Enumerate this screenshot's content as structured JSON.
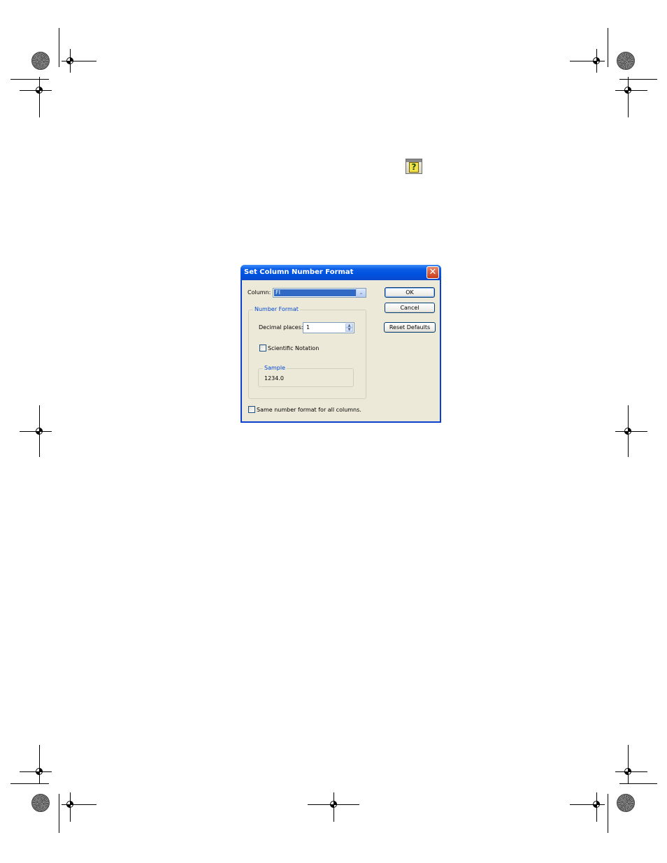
{
  "help_icon": {
    "icon": "help-question-icon",
    "glyph": "?"
  },
  "dialog": {
    "title": "Set Column Number Format",
    "close_glyph": "✕",
    "column": {
      "label": "Column:",
      "value": "FI",
      "arrow": "⌄"
    },
    "buttons": {
      "ok": "OK",
      "cancel": "Cancel",
      "reset": "Reset Defaults"
    },
    "number_format": {
      "legend": "Number Format",
      "decimal_label": "Decimal places:",
      "decimal_value": "1",
      "spin_up": "▲",
      "spin_down": "▼",
      "scientific_label": "Scientific Notation",
      "scientific_checked": false,
      "sample_legend": "Sample",
      "sample_value": "1234.0"
    },
    "same_format_label": "Same number format for all columns.",
    "same_format_checked": false
  }
}
